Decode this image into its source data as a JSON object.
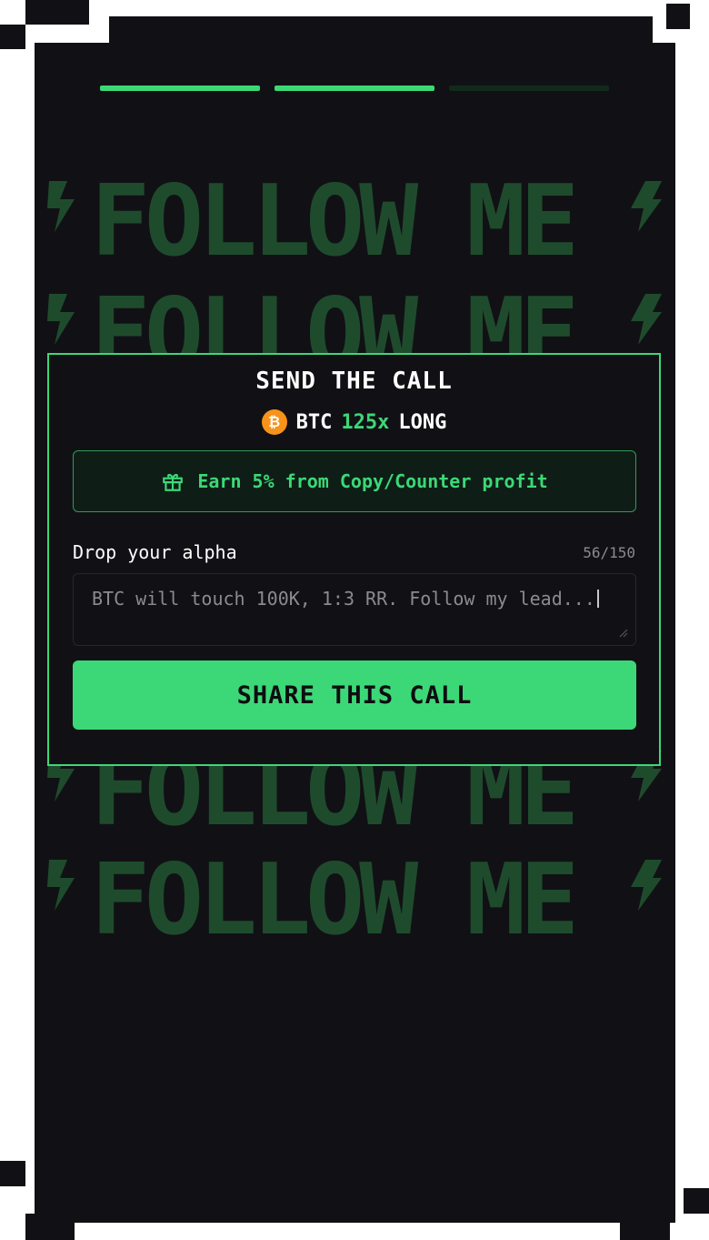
{
  "progress": {
    "total_steps": 3,
    "completed_steps": 2,
    "active_color": "#3cd877",
    "inactive_color": "#122a1b"
  },
  "background": {
    "repeat_text": "FOLLOW ME",
    "text_color": "#1f4b2d"
  },
  "modal": {
    "title": "SEND THE CALL",
    "pair": {
      "symbol": "BTC",
      "coin_glyph": "₿",
      "leverage": "125x",
      "direction": "LONG"
    },
    "reward": {
      "text": "Earn 5% from Copy/Counter profit",
      "icon": "gift-icon"
    },
    "alpha": {
      "label": "Drop your alpha",
      "counter": "56/150",
      "value": "BTC will touch 100K, 1:3 RR. Follow my lead..."
    },
    "share_button": "SHARE THIS CALL"
  },
  "colors": {
    "accent": "#3cd877",
    "background": "#111115",
    "bitcoin": "#f7931a"
  }
}
